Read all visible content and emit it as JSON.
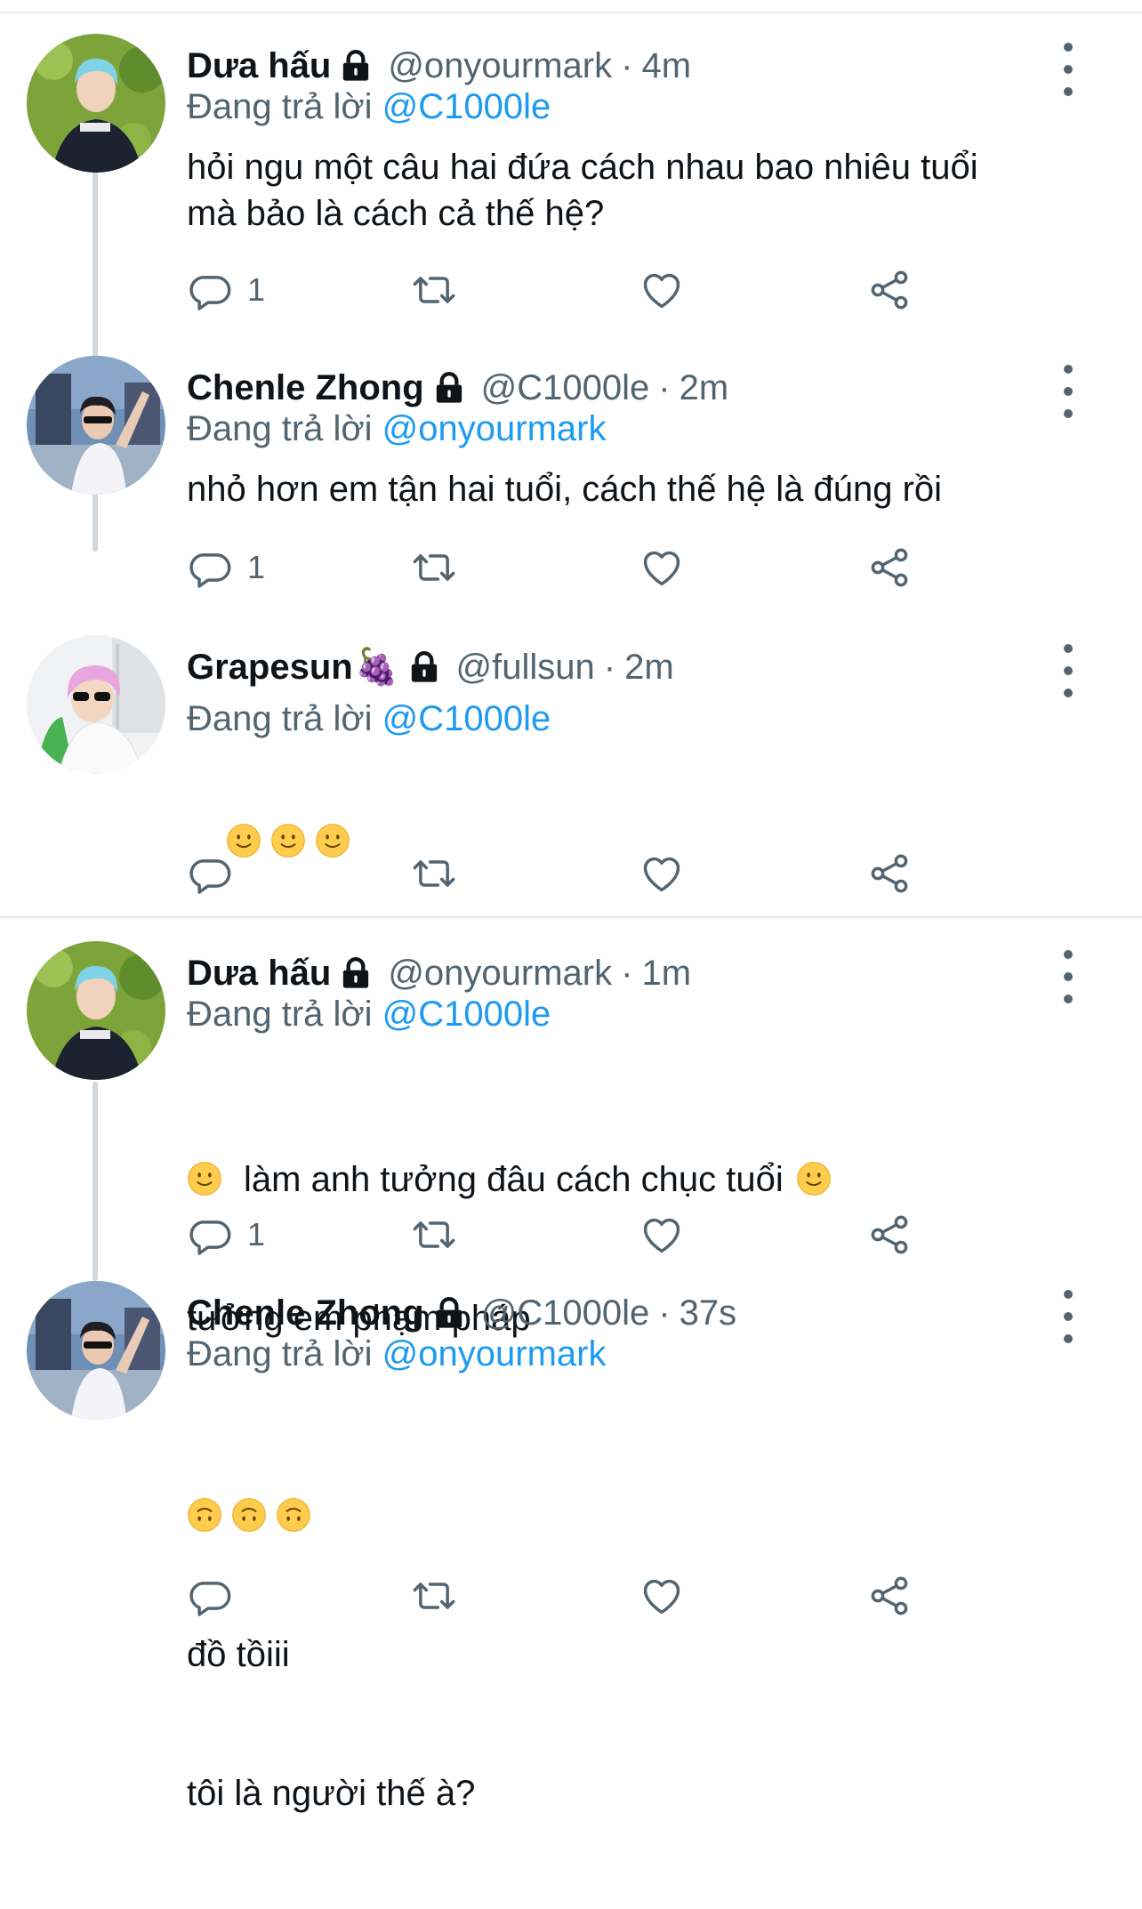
{
  "reply_prefix": "Đang trả lời",
  "tweets": [
    {
      "name": "Dưa hấu",
      "handle": "@onyourmark",
      "dot": "·",
      "time": "4m",
      "reply_to": "@C1000le",
      "text": "hỏi ngu một câu hai đứa cách nhau bao nhiêu tuổi\nmà bảo là cách cả thế hệ?",
      "reply_count": "1",
      "avatar_hair": "#7fd3e6"
    },
    {
      "name": "Chenle Zhong",
      "handle": "@C1000le",
      "dot": "·",
      "time": "2m",
      "reply_to": "@onyourmark",
      "text": "nhỏ hơn em tận hai tuổi, cách thế hệ là đúng rồi",
      "reply_count": "1"
    },
    {
      "name": "Grapesun",
      "name_emoji": "🍇",
      "handle": "@fullsun",
      "dot": "·",
      "time": "2m",
      "reply_to": "@C1000le",
      "emojis": "🙂 🙂 🙂",
      "reply_count": ""
    },
    {
      "name": "Dưa hấu",
      "handle": "@onyourmark",
      "dot": "·",
      "time": "1m",
      "reply_to": "@C1000le",
      "line1": "làm anh tưởng đâu cách chục tuổi",
      "line2": "tưởng em phạm pháp",
      "reply_count": "1"
    },
    {
      "name": "Chenle Zhong",
      "handle": "@C1000le",
      "dot": "·",
      "time": "37s",
      "reply_to": "@onyourmark",
      "emojis": "🙃 🙃 🙃",
      "line1": "đồ tồiii",
      "line2": "tôi là người thế à?",
      "reply_count": ""
    }
  ],
  "icons": {
    "reply": "reply-icon",
    "retweet": "retweet-icon",
    "like": "heart-icon",
    "share": "share-icon",
    "lock": "lock-icon",
    "more": "more-icon"
  },
  "colors": {
    "link": "#1d9bf0",
    "secondary_text": "#536471",
    "primary_text": "#0f1419",
    "divider": "#e6e9ec",
    "emoji_yellow": "#ffcc4d"
  }
}
